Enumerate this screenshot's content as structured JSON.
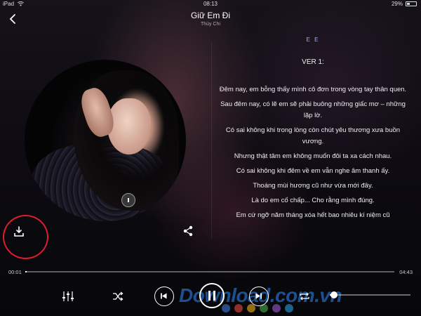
{
  "status_bar": {
    "carrier": "iPad",
    "time": "08:13",
    "battery": "29%"
  },
  "header": {
    "title": "Giữ Em Đi",
    "artist": "Thùy Chi"
  },
  "lyrics": {
    "tag": "E E",
    "section": "VER 1:",
    "lines": [
      "Đêm nay, em bỗng thấy mình cô đơn trong vòng tay thân quen.",
      "Sau đêm nay, có lẽ em sẽ phải buông những giấc mơ – những lặp lờ.",
      "Có sai không khi trong lòng còn chút yêu thương xưa buồn vương.",
      "Nhưng thật tâm em không muốn đôi ta xa cách nhau.",
      "Có sai không khi đêm về em vẫn nghe âm thanh ấy.",
      "Thoáng mùi hương cũ như vừa mới đây.",
      "Là do em cố chấp... Cho rằng mình đúng.",
      "Em cứ ngỡ năm tháng xóa hết bao nhiêu kí niệm cũ"
    ]
  },
  "player": {
    "elapsed": "00:01",
    "total": "04:43",
    "progress_fraction": 0.004,
    "volume_fraction": 0.03
  },
  "watermark": {
    "text": "Download.com.vn",
    "dot_colors": [
      "#3c7dd9",
      "#e94b3c",
      "#f3b41b",
      "#4cae4f",
      "#9b5bd1",
      "#2da0e1"
    ]
  },
  "colors": {
    "highlight_ring": "#e21c2c",
    "lyric_tag": "#9ab0ff"
  }
}
